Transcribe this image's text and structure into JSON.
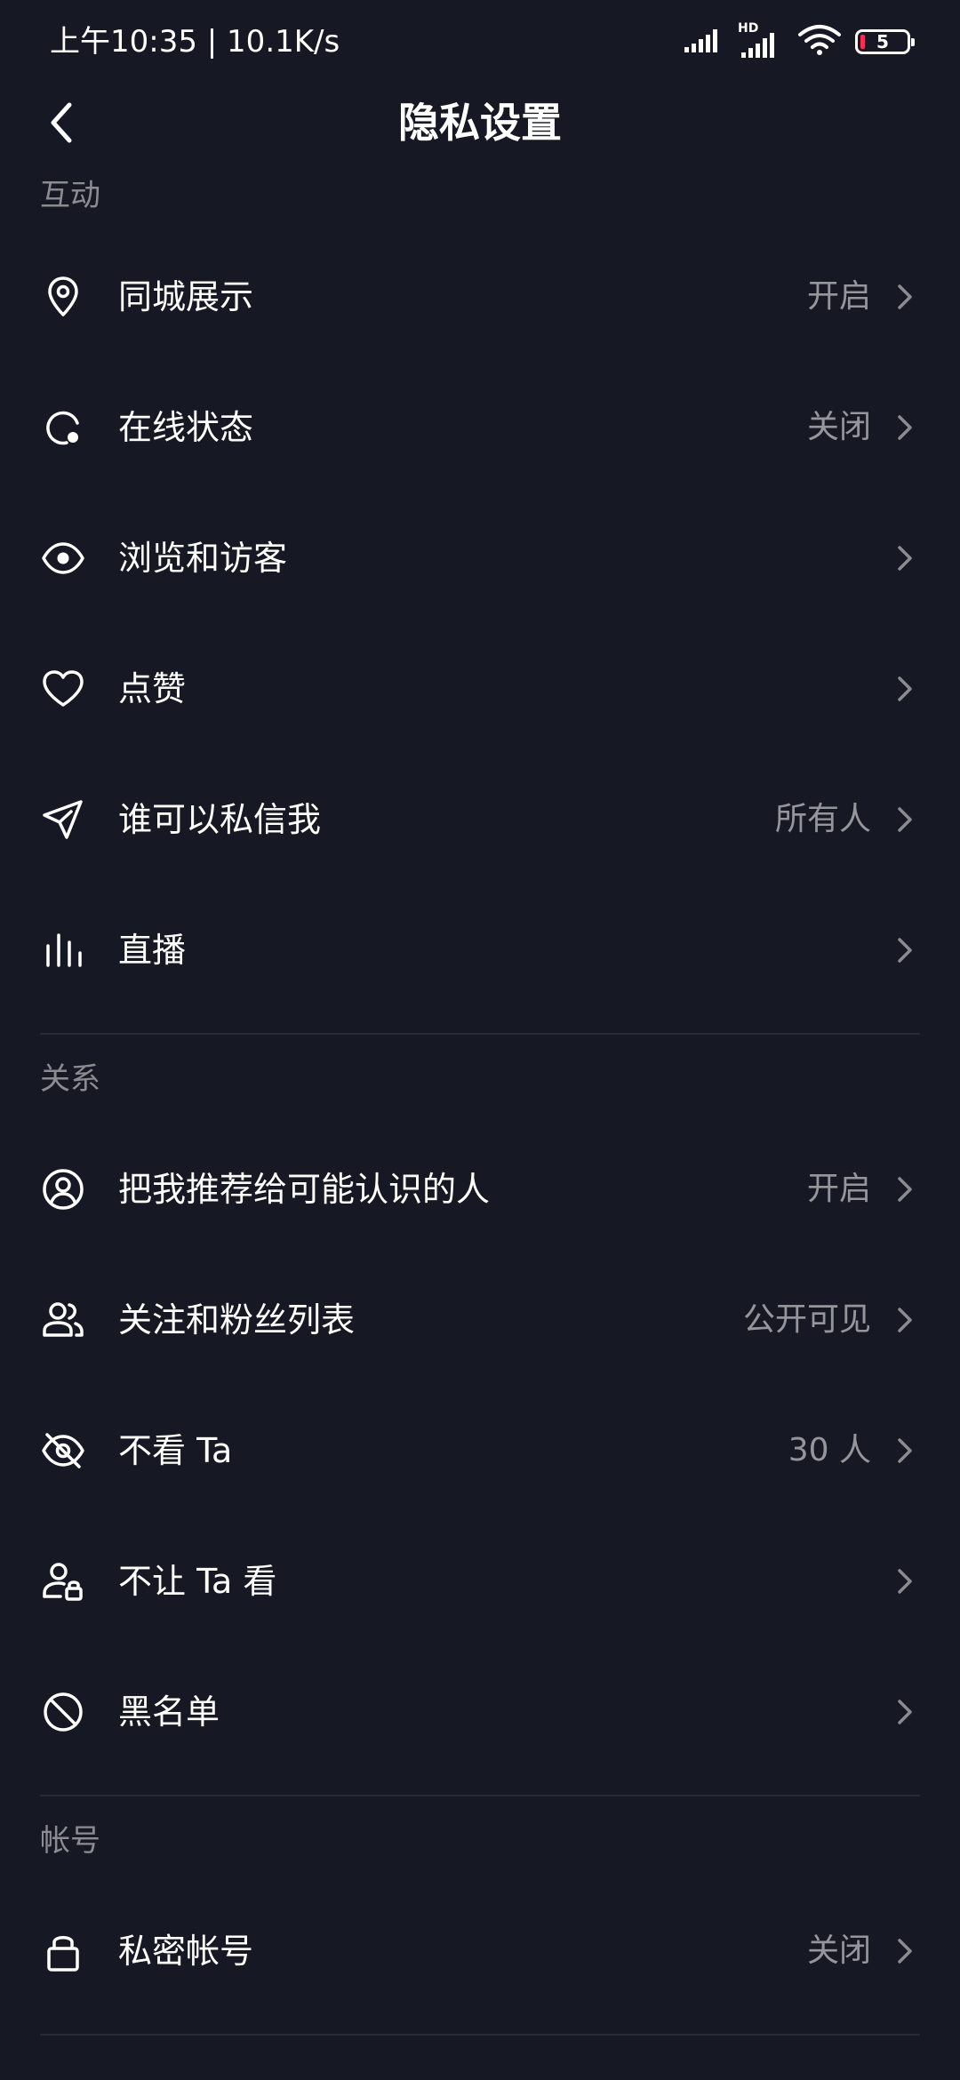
{
  "status_bar": {
    "time_speed": "上午10:35 | 10.1K/s",
    "network_badge": "HD",
    "battery_level": "5"
  },
  "nav": {
    "title": "隐私设置"
  },
  "sections": {
    "interaction": {
      "header": "互动",
      "items": {
        "nearby": {
          "label": "同城展示",
          "value": "开启"
        },
        "online": {
          "label": "在线状态",
          "value": "关闭"
        },
        "visitors": {
          "label": "浏览和访客",
          "value": ""
        },
        "likes": {
          "label": "点赞",
          "value": ""
        },
        "dm": {
          "label": "谁可以私信我",
          "value": "所有人"
        },
        "live": {
          "label": "直播",
          "value": ""
        }
      }
    },
    "relations": {
      "header": "关系",
      "items": {
        "recommend": {
          "label": "把我推荐给可能认识的人",
          "value": "开启"
        },
        "follow_list": {
          "label": "关注和粉丝列表",
          "value": "公开可见"
        },
        "hide_from": {
          "label": "不看 Ta",
          "value": "30 人"
        },
        "block_view": {
          "label": "不让 Ta 看",
          "value": ""
        },
        "blacklist": {
          "label": "黑名单",
          "value": ""
        }
      }
    },
    "account": {
      "header": "帐号",
      "items": {
        "private": {
          "label": "私密帐号",
          "value": "关闭"
        }
      }
    }
  },
  "colors": {
    "background": "#161823",
    "text_primary": "#ffffff",
    "text_secondary": "#8a8b91",
    "battery_low": "#fe2c55"
  }
}
